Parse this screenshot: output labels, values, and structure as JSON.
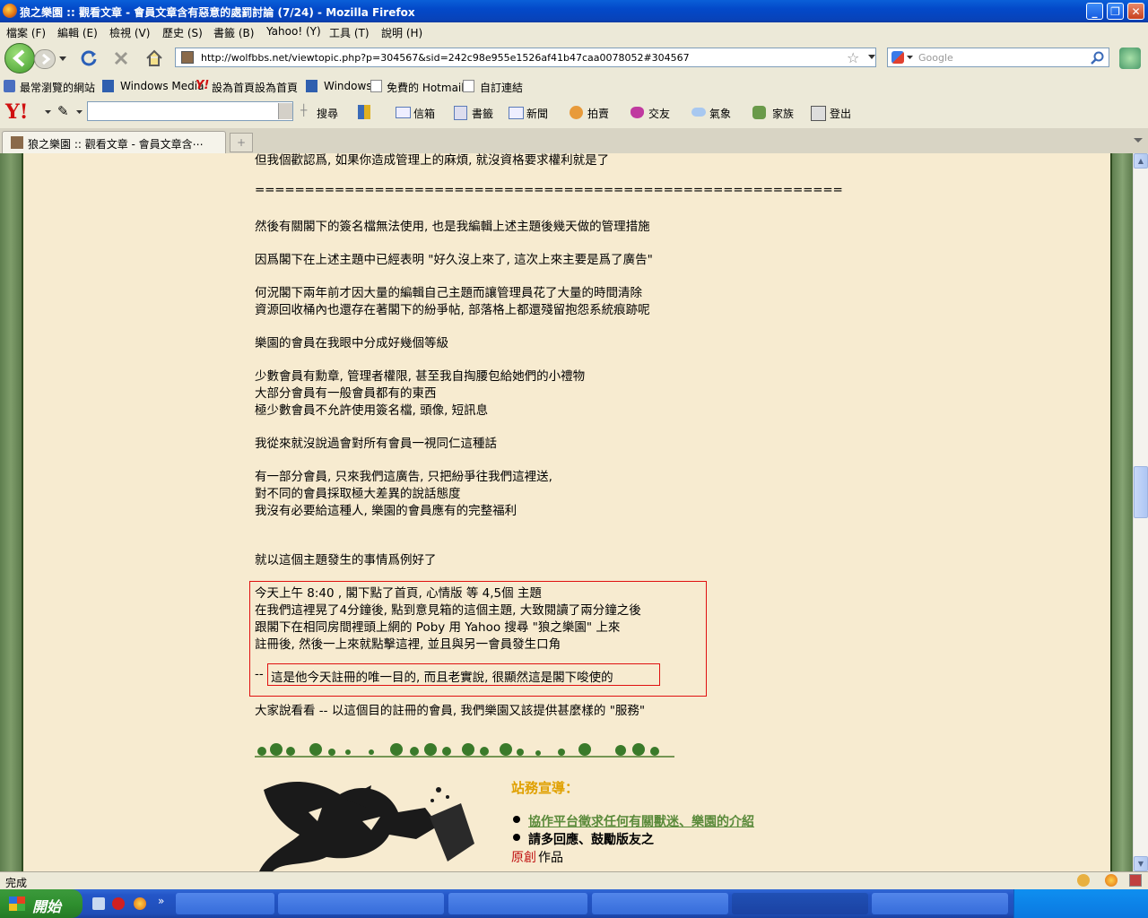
{
  "window": {
    "title": "狼之樂園 :: 觀看文章 - 會員文章含有惡意的處罰討論 (7/24) - Mozilla Firefox"
  },
  "menu": [
    "檔案 (F)",
    "編輯 (E)",
    "檢視 (V)",
    "歷史 (S)",
    "書籤 (B)",
    "Yahoo! (Y)",
    "工具 (T)",
    "說明 (H)"
  ],
  "nav": {
    "url": "http://wolfbbs.net/viewtopic.php?p=304567&sid=242c98e955e1526af41b47caa0078052#304567",
    "search_placeholder": "Google"
  },
  "bookmarks": [
    "最常瀏覽的網站",
    "Windows Media",
    "設為首頁設為首頁",
    "Windows",
    "免費的 Hotmail",
    "自訂連結"
  ],
  "yahoo_toolbar": [
    "搜尋",
    "信箱",
    "書籤",
    "新聞",
    "拍賣",
    "交友",
    "氣象",
    "家族",
    "登出"
  ],
  "tab": {
    "label": "狼之樂園 :: 觀看文章 - 會員文章含⋯"
  },
  "post": {
    "lines": [
      "但我個歡認爲, 如果你造成管理上的麻煩, 就沒資格要求權利就是了",
      "===========================================================",
      "然後有關閣下的簽名檔無法使用, 也是我編輯上述主題後幾天做的管理措施",
      "因爲閣下在上述主題中已經表明 \"好久沒上來了, 這次上來主要是爲了廣告\"",
      "何況閣下兩年前才因大量的編輯自己主題而讓管理員花了大量的時間清除",
      "資源回收桶內也還存在著閣下的紛爭帖, 部落格上都還殘留抱怨系統痕跡呢",
      "樂園的會員在我眼中分成好幾個等級",
      "少數會員有勳章, 管理者權限, 甚至我自掏腰包給她們的小禮物",
      "大部分會員有一般會員都有的東西",
      "極少數會員不允許使用簽名檔, 頭像, 短訊息",
      "我從來就沒說過會對所有會員一視同仁這種話",
      "有一部分會員, 只來我們這廣告, 只把紛爭往我們這裡送,",
      "對不同的會員採取極大差異的說話態度",
      "我沒有必要給這種人, 樂園的會員應有的完整福利",
      "就以這個主題發生的事情爲例好了",
      "今天上午 8:40 , 閣下點了首頁, 心情版 等 4,5個 主題",
      "在我們這裡晃了4分鐘後, 點到意見箱的這個主題, 大致閱讀了兩分鐘之後",
      "跟閣下在相同房間裡頭上網的 Poby 用 Yahoo 搜尋 \"狼之樂園\" 上來",
      "註冊後, 然後一上來就點擊這裡, 並且與另一會員發生口角",
      "--",
      "這是他今天註冊的唯一目的, 而且老實說, 很顯然這是閣下唆使的",
      "大家說看看 -- 以這個目的註冊的會員, 我們樂園又該提供甚麼樣的 \"服務\""
    ]
  },
  "notice": {
    "title": "站務宣導：",
    "link": "協作平台徵求任何有關獸迷、樂園的介紹",
    "item2": "請多回應、鼓勵版友之",
    "item3_red": "原創",
    "item3_rest": "作品"
  },
  "status": {
    "text": "完成"
  },
  "taskbar": {
    "start": "開始"
  }
}
